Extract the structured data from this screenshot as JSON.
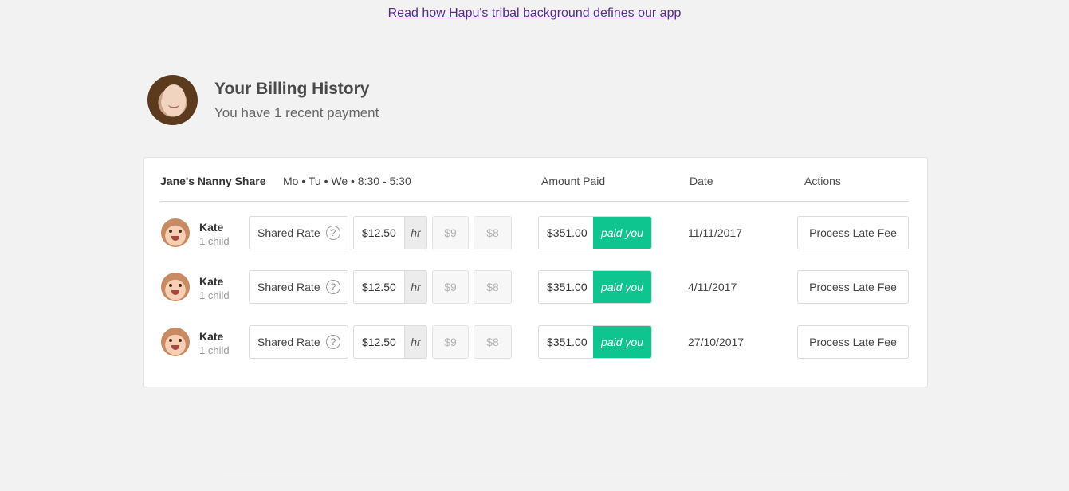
{
  "top_link": "Read how Hapu's tribal background defines our app",
  "header": {
    "title": "Your Billing History",
    "subtitle": "You have 1 recent payment"
  },
  "table": {
    "group_name": "Jane's Nanny Share",
    "schedule": "Mo • Tu • We  •  8:30 - 5:30",
    "columns": {
      "amount": "Amount Paid",
      "date": "Date",
      "actions": "Actions"
    },
    "rows": [
      {
        "name": "Kate",
        "children": "1 child",
        "rate_type": "Shared Rate",
        "help": "?",
        "price": "$12.50",
        "unit": "hr",
        "alt_price_1": "$9",
        "alt_price_2": "$8",
        "amount": "$351.00",
        "paid_label": "paid you",
        "date": "11/11/2017",
        "action": "Process Late Fee"
      },
      {
        "name": "Kate",
        "children": "1 child",
        "rate_type": "Shared Rate",
        "help": "?",
        "price": "$12.50",
        "unit": "hr",
        "alt_price_1": "$9",
        "alt_price_2": "$8",
        "amount": "$351.00",
        "paid_label": "paid you",
        "date": "4/11/2017",
        "action": "Process Late Fee"
      },
      {
        "name": "Kate",
        "children": "1 child",
        "rate_type": "Shared Rate",
        "help": "?",
        "price": "$12.50",
        "unit": "hr",
        "alt_price_1": "$9",
        "alt_price_2": "$8",
        "amount": "$351.00",
        "paid_label": "paid you",
        "date": "27/10/2017",
        "action": "Process Late Fee"
      }
    ]
  },
  "colors": {
    "paid_green": "#0ec48f",
    "link_purple": "#5b2a8c",
    "background": "#f2f2f2"
  }
}
